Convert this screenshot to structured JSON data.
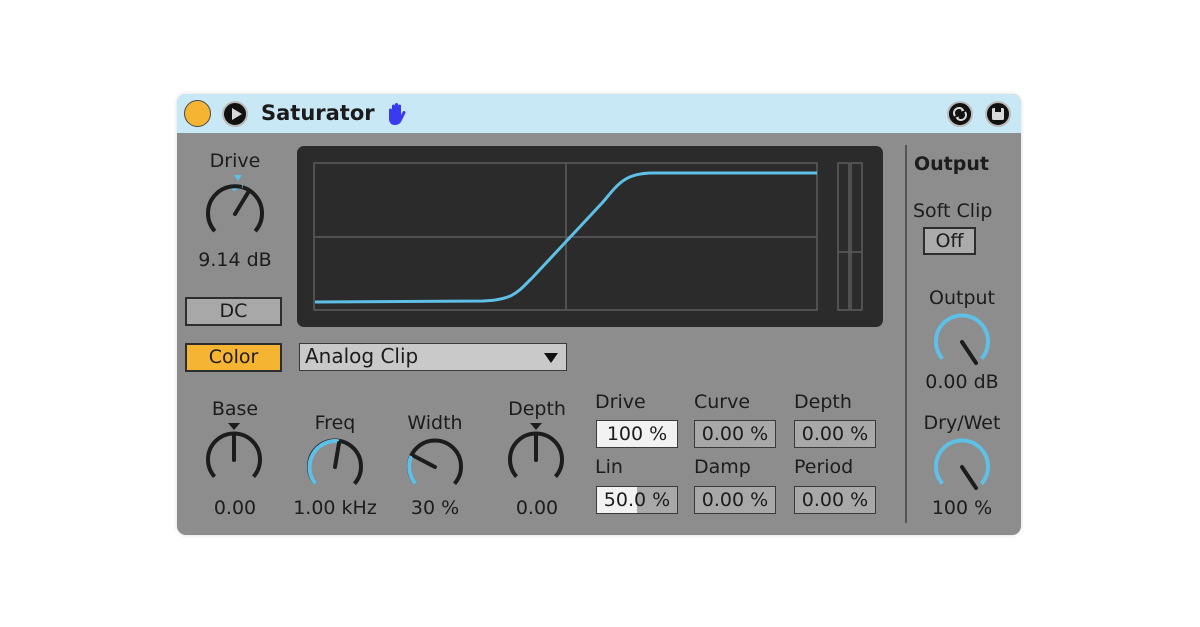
{
  "device": {
    "title": "Saturator",
    "colors": {
      "accent": "#f6b433",
      "curve": "#5ec0e6",
      "header": "#c9e8f6",
      "panel": "#8d8d8d"
    }
  },
  "drive_section": {
    "label": "Drive",
    "value": "9.14 dB",
    "dc_label": "DC",
    "color_label": "Color"
  },
  "curve_type": {
    "selected": "Analog Clip"
  },
  "color_knobs": [
    {
      "label": "Base",
      "value": "0.00"
    },
    {
      "label": "Freq",
      "value": "1.00 kHz"
    },
    {
      "label": "Width",
      "value": "30 %"
    },
    {
      "label": "Depth",
      "value": "0.00"
    }
  ],
  "waveshaper": {
    "drive": {
      "label": "Drive",
      "value": "100 %"
    },
    "curve": {
      "label": "Curve",
      "value": "0.00 %"
    },
    "depth": {
      "label": "Depth",
      "value": "0.00 %"
    },
    "lin": {
      "label": "Lin",
      "value": "50.0 %"
    },
    "damp": {
      "label": "Damp",
      "value": "0.00 %"
    },
    "period": {
      "label": "Period",
      "value": "0.00 %"
    }
  },
  "output_section": {
    "heading": "Output",
    "soft_clip_label": "Soft Clip",
    "soft_clip_value": "Off",
    "output_label": "Output",
    "output_value": "0.00 dB",
    "drywet_label": "Dry/Wet",
    "drywet_value": "100 %"
  },
  "icons": [
    "power-icon",
    "play-icon",
    "hand-icon",
    "hot-swap-icon",
    "save-icon",
    "dropdown-caret-icon"
  ]
}
